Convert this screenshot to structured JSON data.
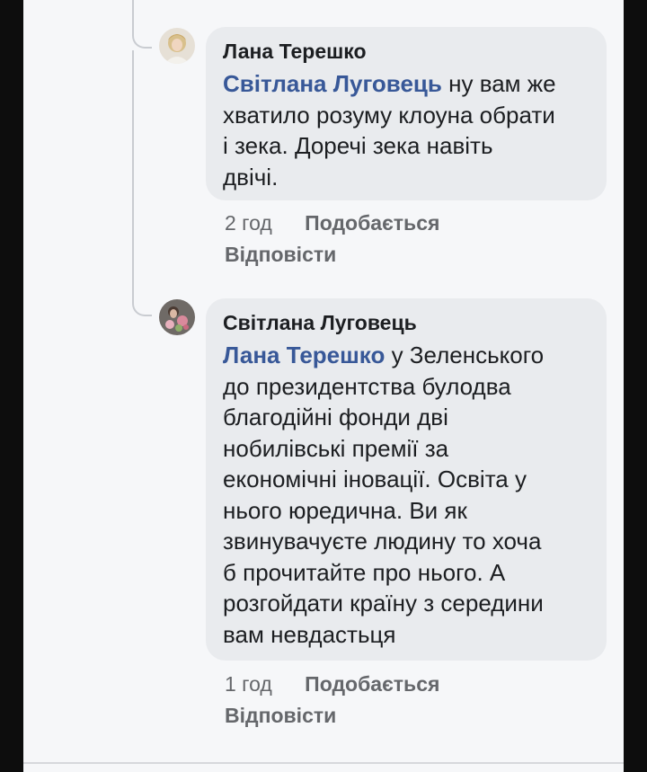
{
  "comments": [
    {
      "author": "Лана Терешко",
      "mention": "Світлана Луговець",
      "text": " ну вам же\nхватило розуму клоуна обрати\nі зека. Доречі зека навіть\nдвічі.",
      "time": "2 год",
      "like_label": "Подобається",
      "reply_label": "Відповісти"
    },
    {
      "author": "Світлана Луговець",
      "mention": "Лана Терешко",
      "text": " у Зеленського\nдо президентства булодва\nблагодійні фонди дві\nнобилівські премії за\nекономічні іновації. Освіта у\nнього юредична. Ви як\nзвинувачуєте людину  то хоча\nб прочитайте про нього. А\nрозгойдати країну з середини\nвам невдастьця",
      "time": "1 год",
      "like_label": "Подобається",
      "reply_label": "Відповісти"
    }
  ],
  "colors": {
    "background": "#f6f7f9",
    "bubble": "#e9ebee",
    "mention": "#385898",
    "text": "#1c1e21",
    "meta": "#65676b"
  }
}
